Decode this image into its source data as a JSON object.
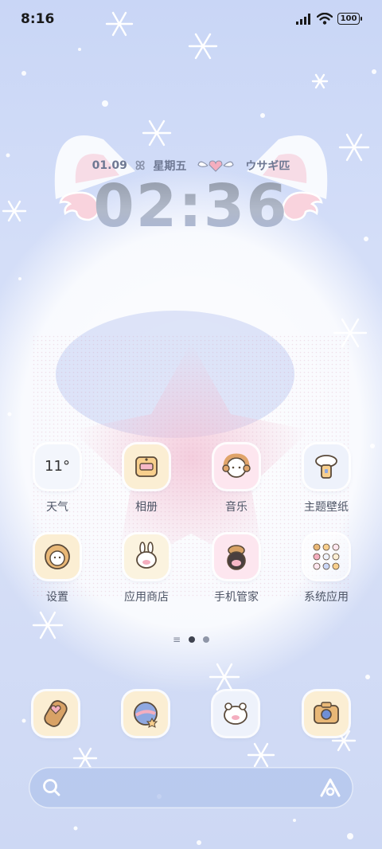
{
  "status_bar": {
    "time": "8:16",
    "battery": "100"
  },
  "widget": {
    "date": "01.09",
    "weekday": "星期五",
    "label": "ウサギ匹",
    "clock": "02:36"
  },
  "apps": [
    {
      "label": "天气",
      "temp": "11°",
      "icon": "weather-icon"
    },
    {
      "label": "相册",
      "icon": "photo-album-icon"
    },
    {
      "label": "音乐",
      "icon": "music-icon"
    },
    {
      "label": "主题壁纸",
      "icon": "theme-wallpaper-icon"
    },
    {
      "label": "设置",
      "icon": "settings-icon"
    },
    {
      "label": "应用商店",
      "icon": "app-store-icon"
    },
    {
      "label": "手机管家",
      "icon": "phone-manager-icon"
    },
    {
      "label": "系统应用",
      "icon": "system-apps-folder-icon"
    }
  ],
  "pages": {
    "count": 2,
    "active": 1
  },
  "dock": [
    "phone-icon",
    "browser-icon",
    "messages-icon",
    "camera-icon"
  ],
  "colors": {
    "bg": "#d4def8",
    "accent_pink": "#f4c3cf",
    "label": "#4e5566"
  }
}
